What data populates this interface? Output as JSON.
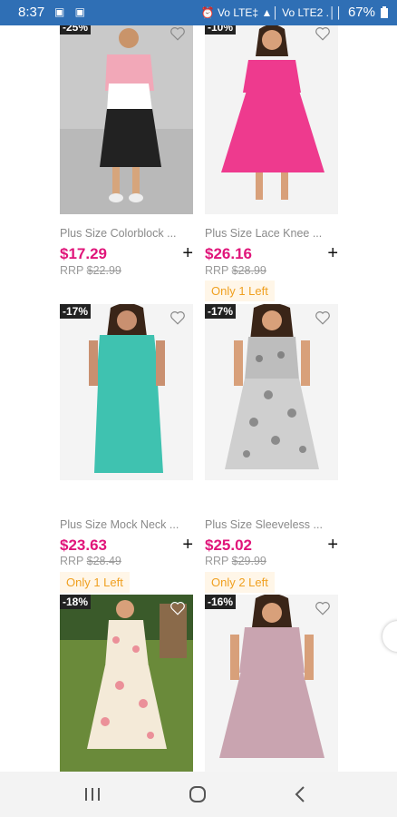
{
  "status_bar": {
    "time": "8:37",
    "left_icons": "▣ ▣",
    "right_icons": "⏰ Vo LTE‡ ▲│ Vo LTE2 .││",
    "battery": "67%"
  },
  "products": [
    {
      "title": "Plus Size Colorblock ...",
      "discount": "-25%",
      "price": "$17.29",
      "rrp_label": "RRP",
      "rrp_value": "$22.99",
      "stock": ""
    },
    {
      "title": "Plus Size Lace Knee ...",
      "discount": "-10%",
      "price": "$26.16",
      "rrp_label": "RRP",
      "rrp_value": "$28.99",
      "stock": "Only 1 Left"
    },
    {
      "title": "Plus Size Mock Neck ...",
      "discount": "-17%",
      "price": "$23.63",
      "rrp_label": "RRP",
      "rrp_value": "$28.49",
      "stock": "Only 1 Left"
    },
    {
      "title": "Plus Size Sleeveless ...",
      "discount": "-17%",
      "price": "$25.02",
      "rrp_label": "RRP",
      "rrp_value": "$29.99",
      "stock": "Only 2 Left"
    },
    {
      "title": "",
      "discount": "-18%",
      "price": "",
      "rrp_label": "",
      "rrp_value": "",
      "stock": ""
    },
    {
      "title": "",
      "discount": "-16%",
      "price": "",
      "rrp_label": "",
      "rrp_value": "",
      "stock": ""
    }
  ],
  "add_symbol": "+",
  "colors": {
    "status_bar": "#2f6fb5",
    "price": "#e0157a",
    "stock_text": "#f0a020",
    "stock_bg": "#fff6e8"
  },
  "icons": {
    "heart": "heart-outline-icon",
    "nav_recent": "recent-apps-icon",
    "nav_home": "home-icon",
    "nav_back": "back-icon"
  }
}
